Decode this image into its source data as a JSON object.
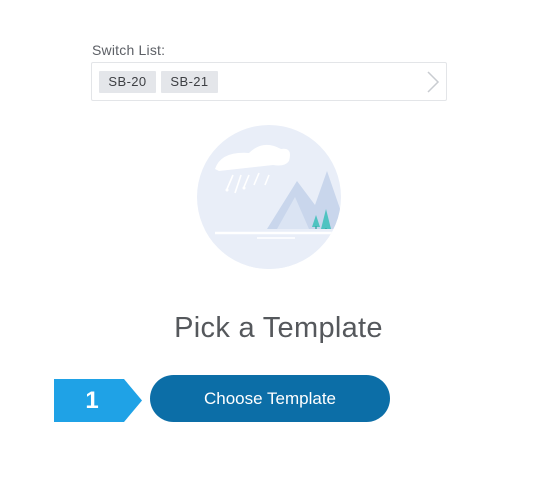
{
  "switch_list": {
    "label": "Switch List:",
    "chips": [
      "SB-20",
      "SB-21"
    ]
  },
  "empty_state": {
    "title": "Pick a Template",
    "illustration": "mountain-lake-weather-illustration"
  },
  "step": {
    "number": "1",
    "color": "#1fa2e6"
  },
  "actions": {
    "choose_template_label": "Choose Template",
    "button_color": "#0c6ea7"
  },
  "icons": {
    "chevron": "chevron-right-icon"
  }
}
